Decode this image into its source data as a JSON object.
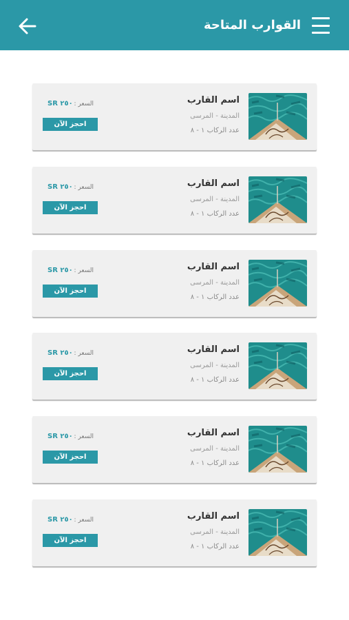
{
  "header": {
    "title": "القوارب المتاحة",
    "back_icon": "arrow-left-icon",
    "menu_icon": "hamburger-menu-icon",
    "color": "#2b98a7"
  },
  "boats": [
    {
      "name": "اسم القارب",
      "location": "المدينة - المرسى",
      "capacity": "عدد الركاب ١ - ٨",
      "price_label": "السعر :",
      "price": "SR ٢٥٠",
      "book_label": "احجز الآن"
    },
    {
      "name": "اسم القارب",
      "location": "المدينة - المرسى",
      "capacity": "عدد الركاب ١ - ٨",
      "price_label": "السعر :",
      "price": "SR ٢٥٠",
      "book_label": "احجز الآن"
    },
    {
      "name": "اسم القارب",
      "location": "المدينة - المرسى",
      "capacity": "عدد الركاب ١ - ٨",
      "price_label": "السعر :",
      "price": "SR ٢٥٠",
      "book_label": "احجز الآن"
    },
    {
      "name": "اسم القارب",
      "location": "المدينة - المرسى",
      "capacity": "عدد الركاب ١ - ٨",
      "price_label": "السعر :",
      "price": "SR ٢٥٠",
      "book_label": "احجز الآن"
    },
    {
      "name": "اسم القارب",
      "location": "المدينة - المرسى",
      "capacity": "عدد الركاب ١ - ٨",
      "price_label": "السعر :",
      "price": "SR ٢٥٠",
      "book_label": "احجز الآن"
    },
    {
      "name": "اسم القارب",
      "location": "المدينة - المرسى",
      "capacity": "عدد الركاب ١ - ٨",
      "price_label": "السعر :",
      "price": "SR ٢٥٠",
      "book_label": "احجز الآن"
    }
  ]
}
